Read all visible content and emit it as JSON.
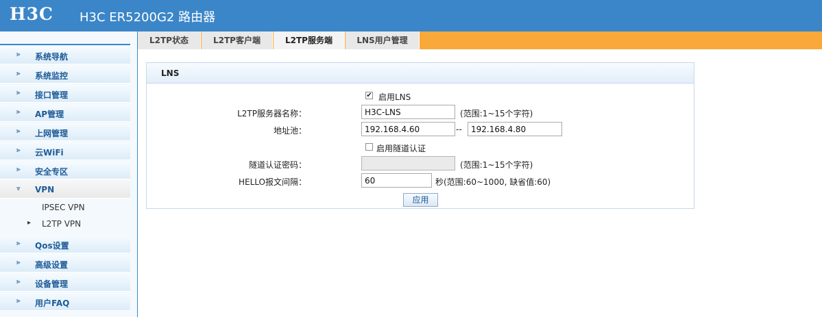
{
  "header": {
    "logo": "H3C",
    "title": "H3C ER5200G2 路由器"
  },
  "sidebar": {
    "items": [
      {
        "label": "系统导航"
      },
      {
        "label": "系统监控"
      },
      {
        "label": "接口管理"
      },
      {
        "label": "AP管理"
      },
      {
        "label": "上网管理"
      },
      {
        "label": "云WiFi"
      },
      {
        "label": "安全专区"
      },
      {
        "label": "VPN"
      },
      {
        "label": "Qos设置"
      },
      {
        "label": "高级设置"
      },
      {
        "label": "设备管理"
      },
      {
        "label": "用户FAQ"
      }
    ],
    "vpn_sub": [
      {
        "label": "IPSEC VPN"
      },
      {
        "label": "L2TP VPN"
      }
    ]
  },
  "tabs": [
    {
      "label": "L2TP状态"
    },
    {
      "label": "L2TP客户端"
    },
    {
      "label": "L2TP服务端"
    },
    {
      "label": "LNS用户管理"
    }
  ],
  "panel": {
    "title": "LNS",
    "enable_lns": {
      "label": "启用LNS",
      "checked": true
    },
    "server_name": {
      "label": "L2TP服务器名称：",
      "value": "H3C-LNS",
      "hint": "(范围:1~15个字符)"
    },
    "address_pool": {
      "label": "地址池：",
      "start": "192.168.4.60",
      "separator": "--",
      "end": "192.168.4.80"
    },
    "tunnel_auth": {
      "label": "启用隧道认证",
      "checked": false
    },
    "tunnel_password": {
      "label": "隧道认证密码：",
      "value": "",
      "hint": "(范围:1~15个字符)"
    },
    "hello_interval": {
      "label": "HELLO报文间隔：",
      "value": "60",
      "hint": "秒(范围:60~1000, 缺省值:60)"
    },
    "apply_label": "应用"
  }
}
